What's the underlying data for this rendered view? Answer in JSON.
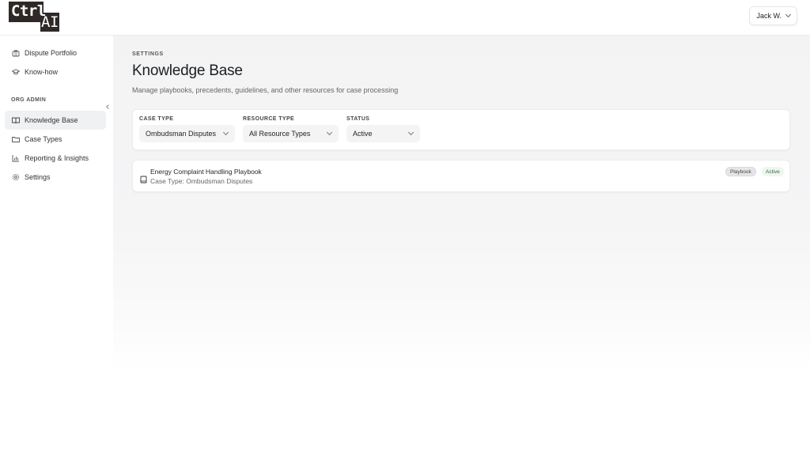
{
  "header": {
    "logo_line1": "Ctrl",
    "logo_line2": "AI",
    "user_label": "Jack W."
  },
  "sidebar": {
    "items_top": [
      {
        "label": "Dispute Portfolio",
        "icon": "briefcase-icon"
      },
      {
        "label": "Know-how",
        "icon": "graduation-cap-icon"
      }
    ],
    "section_label": "ORG ADMIN",
    "items_admin": [
      {
        "label": "Knowledge Base",
        "icon": "book-open-icon",
        "active": true
      },
      {
        "label": "Case Types",
        "icon": "folder-icon"
      },
      {
        "label": "Reporting & Insights",
        "icon": "bar-chart-icon"
      },
      {
        "label": "Settings",
        "icon": "gear-icon"
      }
    ]
  },
  "page": {
    "breadcrumb": "SETTINGS",
    "title": "Knowledge Base",
    "subtitle": "Manage playbooks, precedents, guidelines, and other resources for case processing"
  },
  "filters": {
    "case_type": {
      "label": "CASE TYPE",
      "value": "Ombudsman Disputes"
    },
    "resource_type": {
      "label": "RESOURCE TYPE",
      "value": "All Resource Types"
    },
    "status": {
      "label": "STATUS",
      "value": "Active"
    }
  },
  "resources": [
    {
      "name": "Energy Complaint Handling Playbook",
      "meta": "Case Type: Ombudsman Disputes",
      "type_badge": "Playbook",
      "status_badge": "Active"
    }
  ],
  "colors": {
    "logo_bg": "#2e2926",
    "active_nav_bg": "#f0f1f3",
    "status_active_bg": "#eef6ef",
    "status_active_text": "#2d6b3a"
  }
}
